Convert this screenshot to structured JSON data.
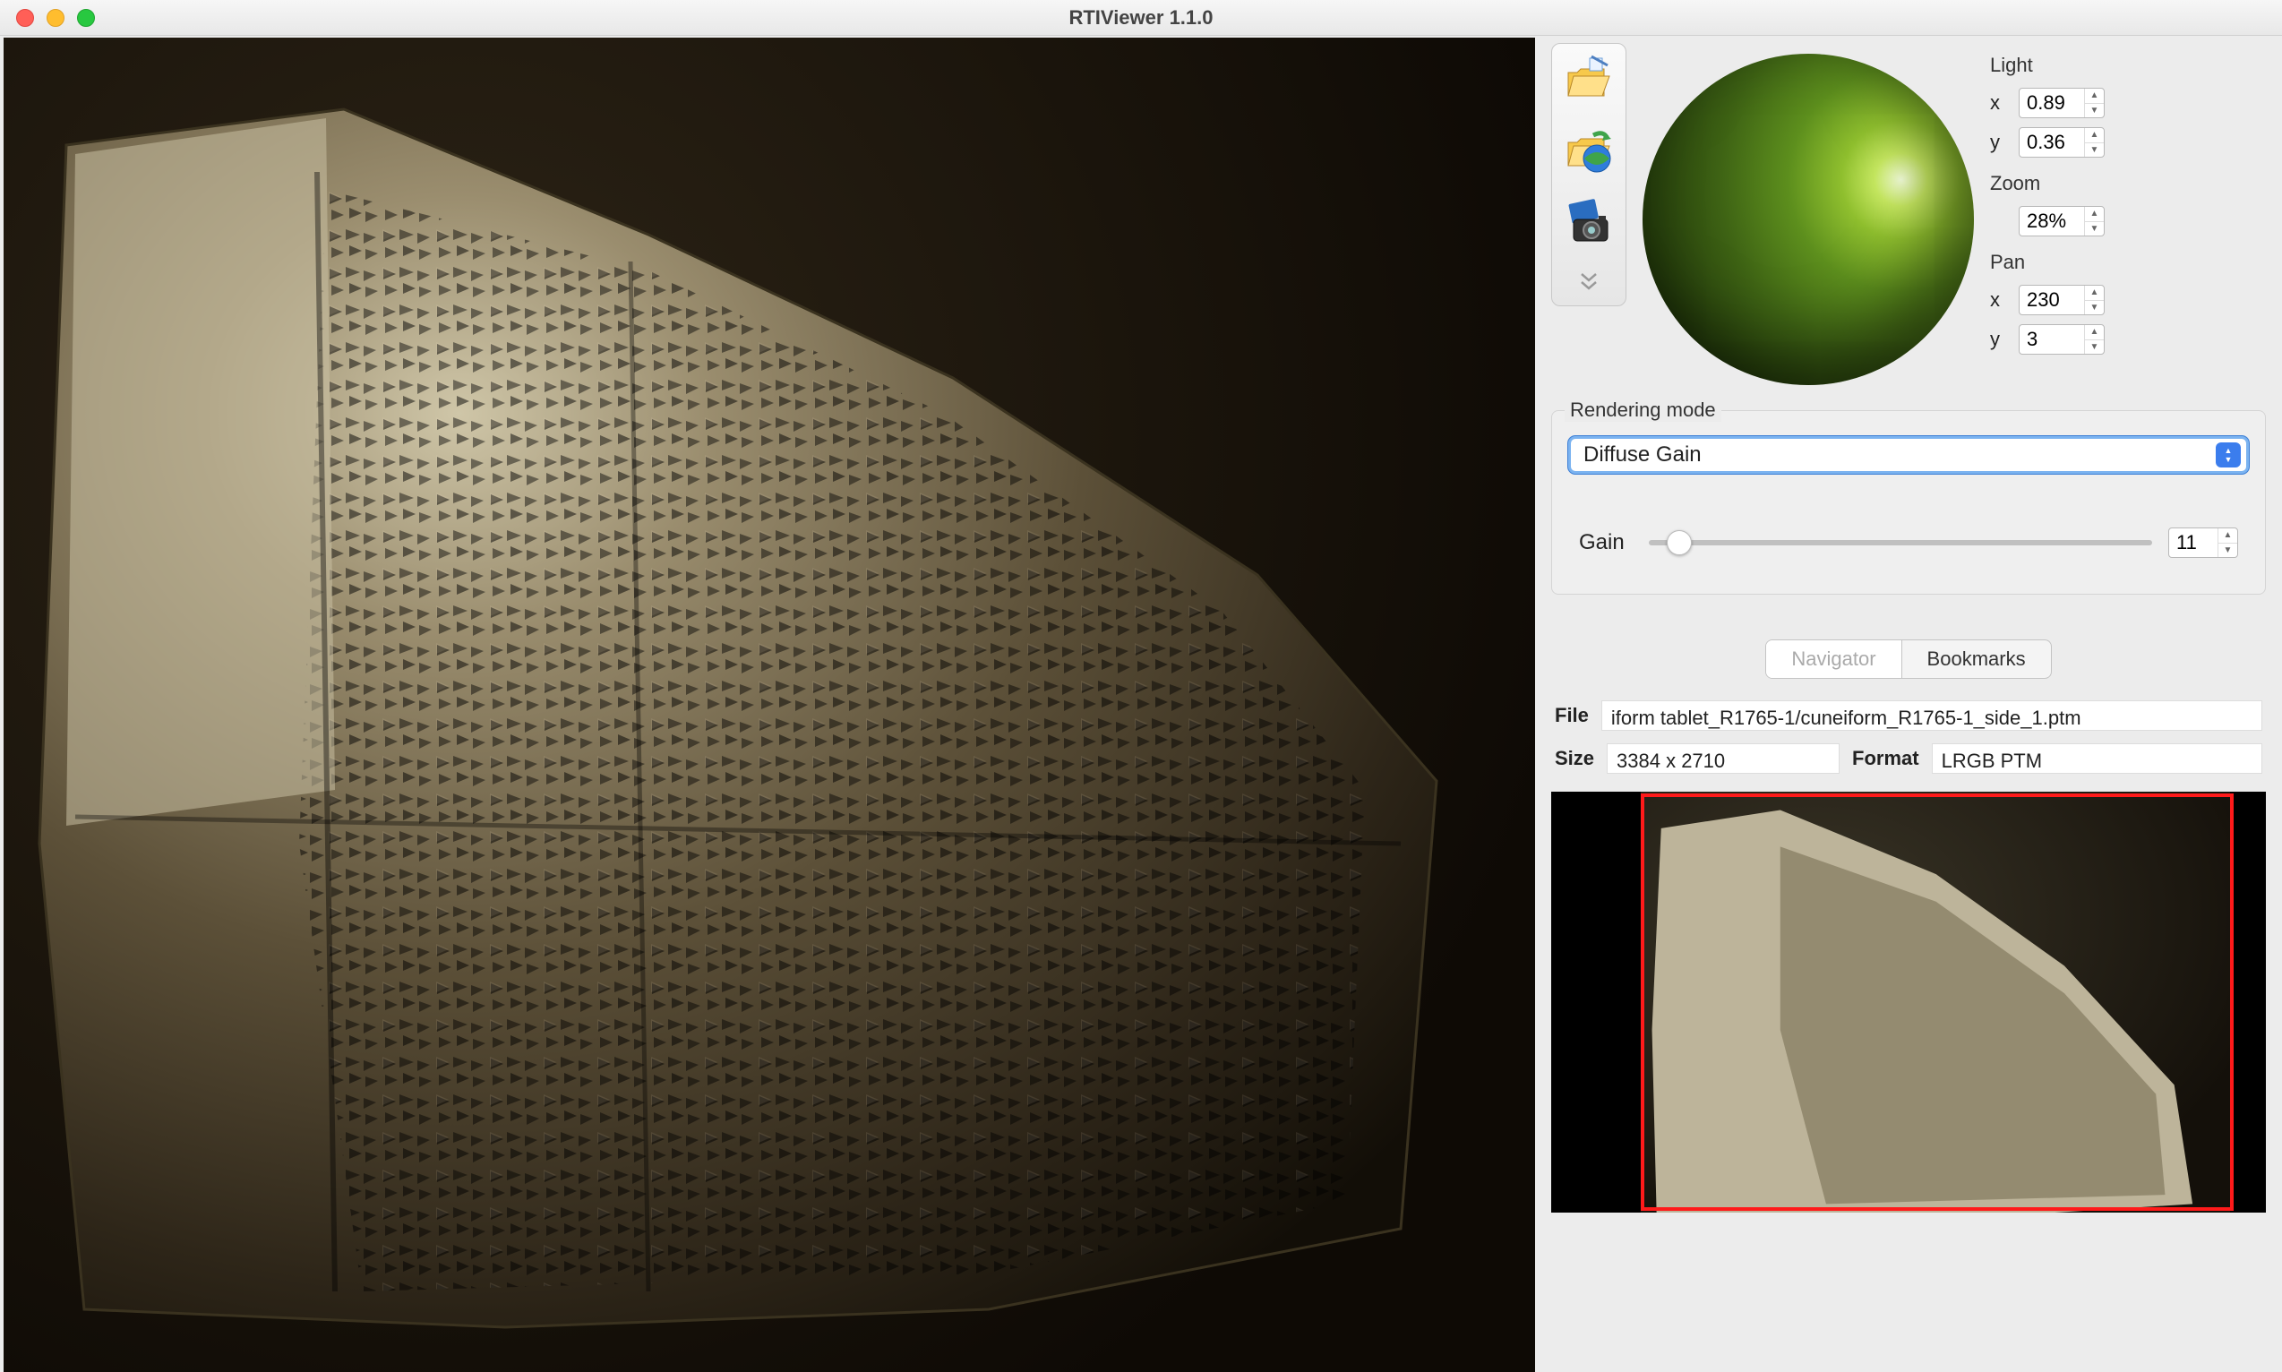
{
  "window": {
    "title": "RTIViewer 1.1.0"
  },
  "toolbar": {
    "icons": [
      "open-file-icon",
      "open-remote-icon",
      "snapshot-icon"
    ]
  },
  "light": {
    "group_label": "Light",
    "x_label": "x",
    "x_value": "0.89",
    "y_label": "y",
    "y_value": "0.36"
  },
  "zoom": {
    "group_label": "Zoom",
    "value": "28%"
  },
  "pan": {
    "group_label": "Pan",
    "x_label": "x",
    "x_value": "230",
    "y_label": "y",
    "y_value": "3"
  },
  "rendering": {
    "legend": "Rendering mode",
    "mode": "Diffuse Gain",
    "gain_label": "Gain",
    "gain_value": "11"
  },
  "tabs": {
    "navigator": "Navigator",
    "bookmarks": "Bookmarks"
  },
  "info": {
    "file_label": "File",
    "file_value": "iform tablet_R1765-1/cuneiform_R1765-1_side_1.ptm",
    "size_label": "Size",
    "size_value": "3384 x 2710",
    "format_label": "Format",
    "format_value": "LRGB PTM"
  }
}
